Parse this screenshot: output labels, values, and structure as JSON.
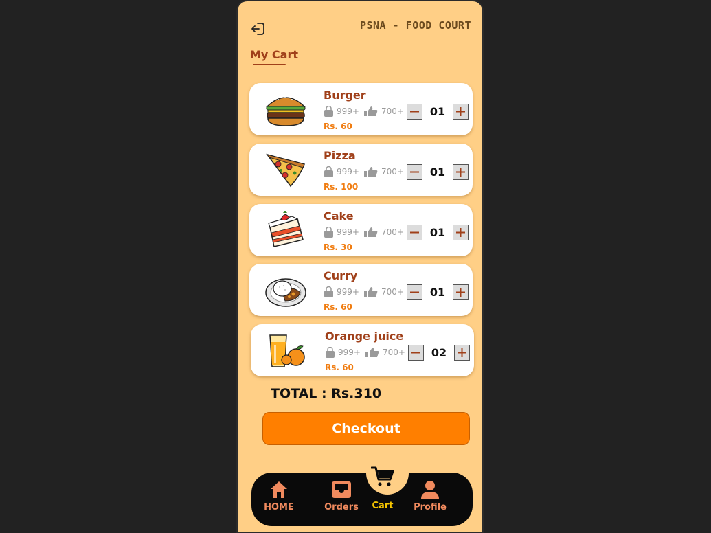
{
  "header": {
    "app_title": "PSNA - FOOD COURT",
    "page_title": "My Cart"
  },
  "cart": {
    "items": [
      {
        "name": "Burger",
        "bought": "999+",
        "likes": "700+",
        "price": "Rs. 60",
        "qty": "01",
        "icon": "burger-image"
      },
      {
        "name": "Pizza",
        "bought": "999+",
        "likes": "700+",
        "price": "Rs. 100",
        "qty": "01",
        "icon": "pizza-image"
      },
      {
        "name": "Cake",
        "bought": "999+",
        "likes": "700+",
        "price": "Rs. 30",
        "qty": "01",
        "icon": "cake-image"
      },
      {
        "name": "Curry",
        "bought": "999+",
        "likes": "700+",
        "price": "Rs. 60",
        "qty": "01",
        "icon": "curry-image"
      },
      {
        "name": "Orange juice",
        "bought": "999+",
        "likes": "700+",
        "price": "Rs. 60",
        "qty": "02",
        "icon": "orange-juice-image"
      }
    ],
    "total": "TOTAL : Rs.310",
    "checkout_label": "Checkout"
  },
  "nav": {
    "home": "HOME",
    "orders": "Orders",
    "cart": "Cart",
    "profile": "Profile"
  },
  "colors": {
    "background": "#ffcf86",
    "accent": "#ff7f00",
    "title": "#a0401a",
    "price": "#f07c10",
    "nav_bg": "#0a0a0a",
    "nav_icon": "#f08a5e",
    "nav_active": "#f5c400"
  }
}
